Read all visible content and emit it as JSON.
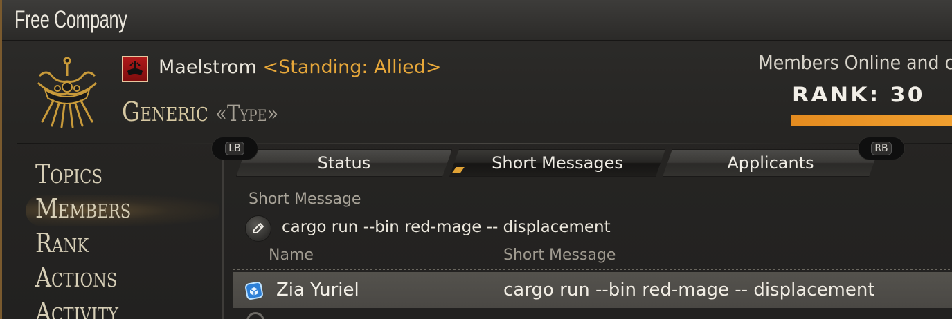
{
  "window": {
    "title": "Free Company"
  },
  "header": {
    "grand_company": "Maelstrom",
    "standing": "<Standing: Allied>",
    "fc_name": "Generic",
    "fc_tag": "«Type»",
    "members_online_label": "Members Online and c",
    "rank_label": "RANK: 30",
    "rank_progress_fraction": 1.0,
    "crest_icon": "fc-crest-icon",
    "flag_icon": "maelstrom-flag-icon"
  },
  "nav": {
    "items": [
      {
        "label": "Topics"
      },
      {
        "label": "Members"
      },
      {
        "label": "Rank"
      },
      {
        "label": "Actions"
      },
      {
        "label": "Activity"
      }
    ],
    "selected": "Members"
  },
  "tabs": {
    "lb": "LB",
    "rb": "RB",
    "items": [
      {
        "label": "Status"
      },
      {
        "label": "Short Messages"
      },
      {
        "label": "Applicants"
      }
    ],
    "active": "Short Messages"
  },
  "short_message": {
    "label": "Short Message",
    "value": "cargo run --bin red-mage -- displacement"
  },
  "members_table": {
    "columns": [
      "Name",
      "Short Message"
    ],
    "rows": [
      {
        "name": "Zia Yuriel",
        "message": "cargo run --bin red-mage -- displacement",
        "status_icon": "online-status-icon"
      }
    ]
  },
  "colors": {
    "accent_orange": "#e8a83a",
    "rank_bar": "#e48b1f",
    "flag_red": "#b01a1a"
  }
}
